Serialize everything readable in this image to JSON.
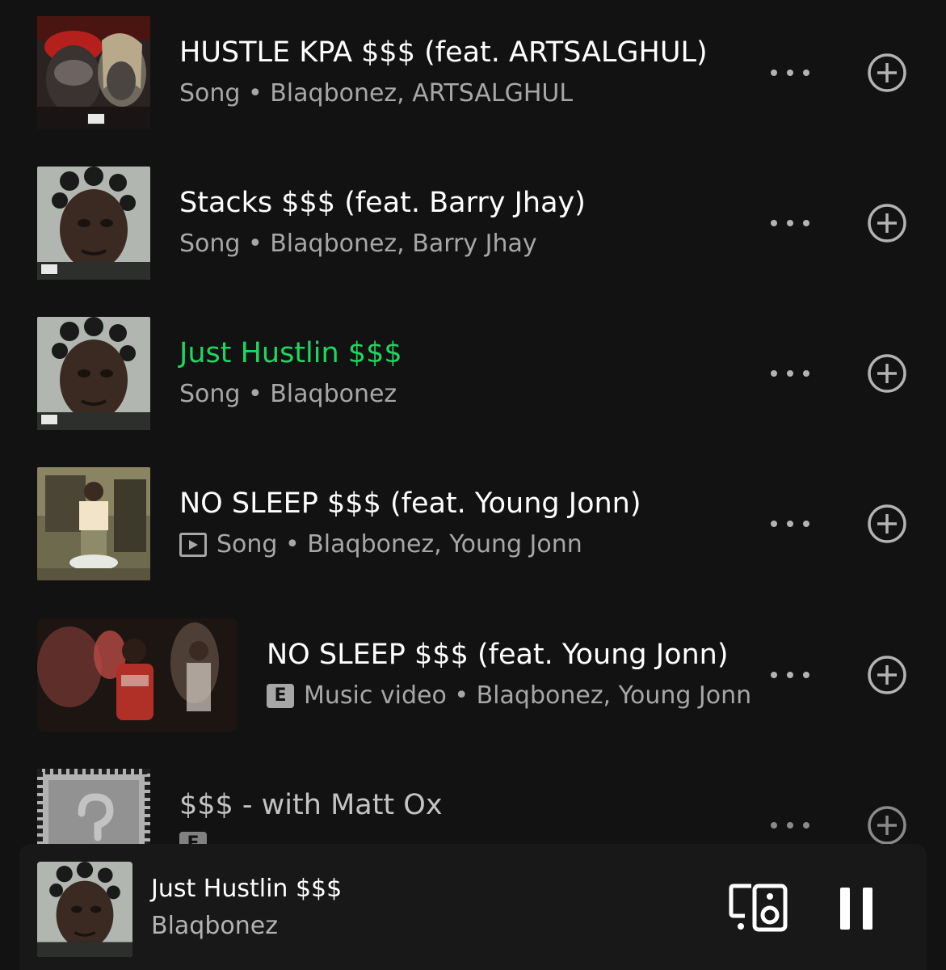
{
  "results": [
    {
      "title": "HUSTLE KPA $$$ (feat. ARTSALGHUL)",
      "subtitle": "Song • Blaqbonez, ARTSALGHUL",
      "badge": "none",
      "art_icon": "album-art-hustle-kpa"
    },
    {
      "title": "Stacks $$$ (feat. Barry Jhay)",
      "subtitle": "Song • Blaqbonez, Barry Jhay",
      "badge": "none",
      "art_icon": "album-art-stacks"
    },
    {
      "title": "Just Hustlin $$$",
      "subtitle": "Song • Blaqbonez",
      "badge": "none",
      "art_icon": "album-art-just-hustlin",
      "now_playing": true
    },
    {
      "title": "NO SLEEP $$$ (feat. Young Jonn)",
      "subtitle": "Song • Blaqbonez, Young Jonn",
      "badge": "video-icon",
      "art_icon": "album-art-no-sleep"
    },
    {
      "title": "NO SLEEP $$$ (feat. Young Jonn)",
      "subtitle": "Music video • Blaqbonez, Young Jonn",
      "badge": "E",
      "art_icon": "video-thumbnail-no-sleep"
    },
    {
      "title": "$$$ - with Matt Ox",
      "subtitle": "",
      "badge": "E",
      "art_icon": "album-art-question-mark"
    }
  ],
  "player": {
    "title": "Just Hustlin $$$",
    "artist": "Blaqbonez"
  },
  "colors": {
    "background": "#121212",
    "now_playing": "#1ed760",
    "secondary_text": "#a7a7a7",
    "miniplayer": "#181818"
  }
}
